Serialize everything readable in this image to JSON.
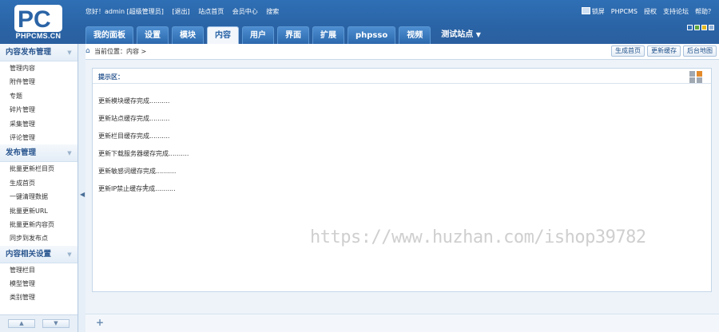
{
  "brand": {
    "logo_text": "PHPCMS.CN"
  },
  "topbar": {
    "greeting": "您好！admin [超级管理员]",
    "logout": "[退出]",
    "site_home": "站点首页",
    "member_center": "会员中心",
    "search": "搜索"
  },
  "topright": {
    "lock": "锁屏",
    "phpcms": "PHPCMS",
    "license": "授权",
    "forum": "支持论坛",
    "help": "帮助？"
  },
  "colors": {
    "header": "#2b64a6",
    "accent": "#2a64a6",
    "swatches": [
      "#2f6fb5",
      "#5ca53c",
      "#e1b822",
      "#8fb0d6"
    ]
  },
  "tabs": [
    "我的面板",
    "设置",
    "模块",
    "内容",
    "用户",
    "界面",
    "扩展",
    "phpsso",
    "视频"
  ],
  "active_tab": "内容",
  "site_switch": "测试站点",
  "sidebar": {
    "sections": [
      {
        "title": "内容发布管理",
        "items": [
          "管理内容",
          "附件管理",
          "专题",
          "碎片管理",
          "采集管理",
          "评论管理"
        ]
      },
      {
        "title": "发布管理",
        "items": [
          "批量更新栏目页",
          "生成首页",
          "一键清理数据",
          "批量更新URL",
          "批量更新内容页",
          "同步到发布点"
        ]
      },
      {
        "title": "内容相关设置",
        "items": [
          "管理栏目",
          "模型管理",
          "类别管理"
        ]
      }
    ]
  },
  "breadcrumb": "当前位置：内容 >",
  "actions": [
    "生成首页",
    "更新缓存",
    "后台地图"
  ],
  "panel": {
    "title": "提示区：",
    "messages": [
      "更新模块缓存完成..........",
      "更新站点缓存完成..........",
      "更新栏目缓存完成..........",
      "更新下载服务器缓存完成..........",
      "更新敏感词缓存完成..........",
      "更新IP禁止缓存完成.........."
    ]
  },
  "watermark": "https://www.huzhan.com/ishop39782"
}
